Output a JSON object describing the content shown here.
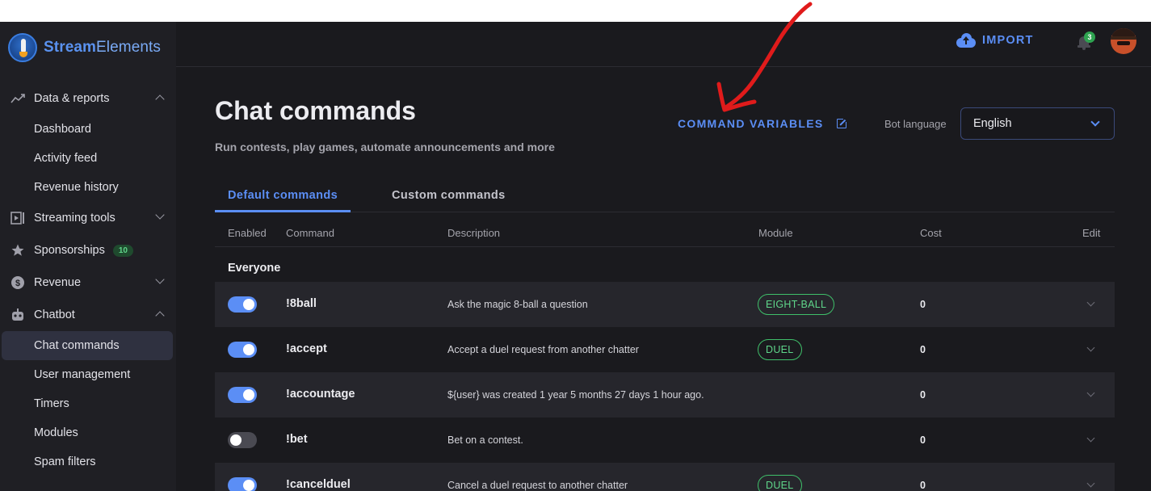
{
  "brand": {
    "name_bold": "Stream",
    "name_light": "Elements"
  },
  "sidebar": {
    "groups": [
      {
        "label": "Data & reports",
        "icon": "trending-icon",
        "expanded": true,
        "items": [
          "Dashboard",
          "Activity feed",
          "Revenue history"
        ]
      },
      {
        "label": "Streaming tools",
        "icon": "streaming-icon",
        "expanded": false,
        "items": []
      },
      {
        "label": "Sponsorships",
        "icon": "star-icon",
        "badge": "10",
        "items": []
      },
      {
        "label": "Revenue",
        "icon": "dollar-icon",
        "expanded": false,
        "items": []
      },
      {
        "label": "Chatbot",
        "icon": "robot-icon",
        "expanded": true,
        "items": [
          "Chat commands",
          "User management",
          "Timers",
          "Modules",
          "Spam filters"
        ]
      }
    ],
    "active_item": "Chat commands"
  },
  "topbar": {
    "import_label": "IMPORT",
    "notification_count": "3"
  },
  "page": {
    "title": "Chat commands",
    "subtitle": "Run contests, play games, automate announcements and more",
    "command_variables_label": "COMMAND VARIABLES",
    "bot_language_label": "Bot language",
    "bot_language_value": "English"
  },
  "tabs": [
    {
      "label": "Default commands",
      "active": true
    },
    {
      "label": "Custom commands",
      "active": false
    }
  ],
  "table": {
    "headers": {
      "enabled": "Enabled",
      "command": "Command",
      "description": "Description",
      "module": "Module",
      "cost": "Cost",
      "edit": "Edit"
    },
    "group": "Everyone",
    "rows": [
      {
        "enabled": true,
        "command": "!8ball",
        "description": "Ask the magic 8-ball a question",
        "module": "EIGHT-BALL",
        "cost": "0"
      },
      {
        "enabled": true,
        "command": "!accept",
        "description": "Accept a duel request from another chatter",
        "module": "DUEL",
        "cost": "0"
      },
      {
        "enabled": true,
        "command": "!accountage",
        "description": "${user} was created 1 year 5 months 27 days 1 hour ago.",
        "module": "",
        "cost": "0"
      },
      {
        "enabled": false,
        "command": "!bet",
        "description": "Bet on a contest.",
        "module": "",
        "cost": "0"
      },
      {
        "enabled": true,
        "command": "!cancelduel",
        "description": "Cancel a duel request to another chatter",
        "module": "DUEL",
        "cost": "0"
      }
    ]
  },
  "colors": {
    "accent": "#5b8ef5",
    "module_green": "#5fd68a",
    "annotation_red": "#e01b1b"
  }
}
